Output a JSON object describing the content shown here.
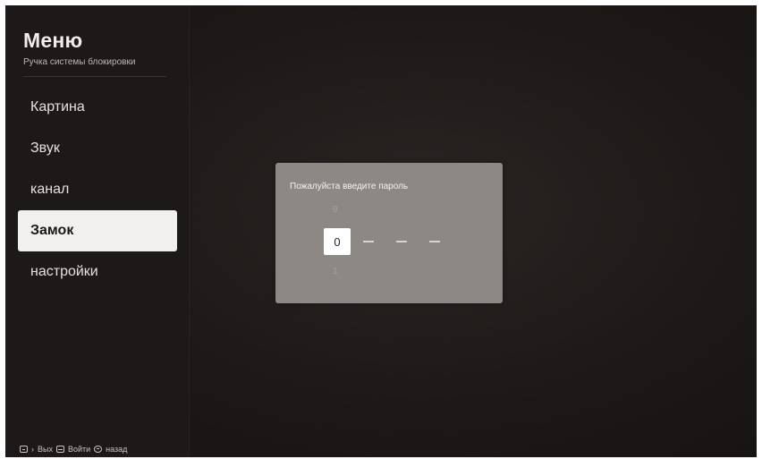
{
  "menu": {
    "title": "Меню",
    "subtitle": "Ручка системы блокировки",
    "items": [
      {
        "label": "Картина",
        "active": false
      },
      {
        "label": "Звук",
        "active": false
      },
      {
        "label": "канал",
        "active": false
      },
      {
        "label": "Замок",
        "active": true
      },
      {
        "label": "настройки",
        "active": false
      }
    ]
  },
  "footer": {
    "exit_label": "Вых",
    "enter_label": "Войти",
    "back_label": "назад",
    "icons": [
      "menu-icon",
      "ok-icon",
      "back-icon"
    ]
  },
  "dialog": {
    "title": "Пожалуйста введите пароль",
    "digit_above": "9",
    "digit_current": "0",
    "digit_below": "1",
    "placeholder": "—",
    "total_digits": 4
  },
  "colors": {
    "background": "#1c1817",
    "sidebar": "#1d1918",
    "active_item": "#f2f0ee",
    "dialog": "#8d8884"
  }
}
